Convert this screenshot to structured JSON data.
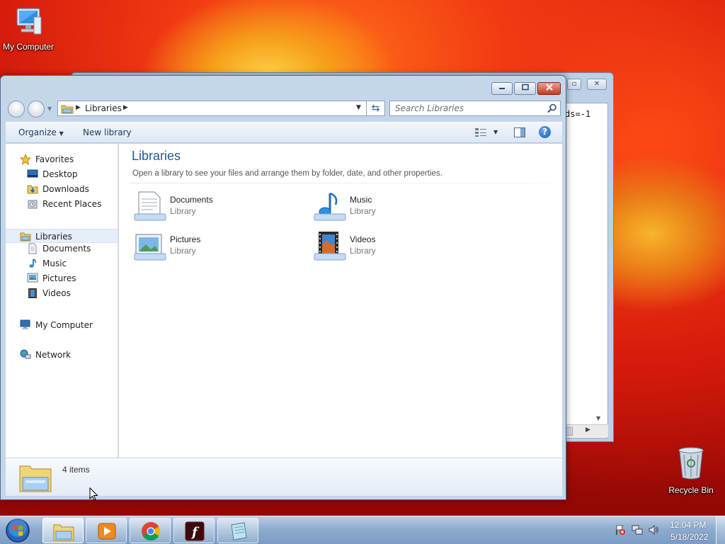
{
  "desktop": {
    "icons": [
      {
        "label": "My Computer"
      },
      {
        "label": "Recycle Bin"
      }
    ]
  },
  "background_window": {
    "visible_text": "ds=-1"
  },
  "explorer": {
    "address": {
      "crumbs": [
        "Libraries"
      ]
    },
    "search": {
      "placeholder": "Search Libraries"
    },
    "toolbar": {
      "organize_label": "Organize",
      "new_library_label": "New library"
    },
    "nav_pane": {
      "favorites": {
        "label": "Favorites",
        "items": [
          {
            "label": "Desktop",
            "icon": "desktop-icon"
          },
          {
            "label": "Downloads",
            "icon": "downloads-folder-icon"
          },
          {
            "label": "Recent Places",
            "icon": "recent-places-icon"
          }
        ]
      },
      "libraries": {
        "label": "Libraries",
        "selected": true,
        "items": [
          {
            "label": "Documents",
            "icon": "documents-icon"
          },
          {
            "label": "Music",
            "icon": "music-icon"
          },
          {
            "label": "Pictures",
            "icon": "pictures-icon"
          },
          {
            "label": "Videos",
            "icon": "videos-icon"
          }
        ]
      },
      "computer": {
        "label": "My Computer"
      },
      "network": {
        "label": "Network"
      }
    },
    "content": {
      "title": "Libraries",
      "subtitle": "Open a library to see your files and arrange them by folder, date, and other properties.",
      "libraries": [
        {
          "name": "Documents",
          "kind": "Library",
          "icon": "documents-library-icon"
        },
        {
          "name": "Music",
          "kind": "Library",
          "icon": "music-library-icon"
        },
        {
          "name": "Pictures",
          "kind": "Library",
          "icon": "pictures-library-icon"
        },
        {
          "name": "Videos",
          "kind": "Library",
          "icon": "videos-library-icon"
        }
      ]
    },
    "details": {
      "item_count": "4 items"
    }
  },
  "taskbar": {
    "buttons": [
      {
        "name": "windows-explorer",
        "active": true
      },
      {
        "name": "media-player",
        "active": false
      },
      {
        "name": "chrome",
        "active": false
      },
      {
        "name": "flash",
        "active": false
      },
      {
        "name": "notepad",
        "active": false
      }
    ],
    "clock": {
      "time": "12:04 PM",
      "date": "5/18/2022"
    }
  },
  "colors": {
    "accent_title": "#1e5b96",
    "selection": "#e5eef9",
    "close_button": "#c23c1e"
  }
}
